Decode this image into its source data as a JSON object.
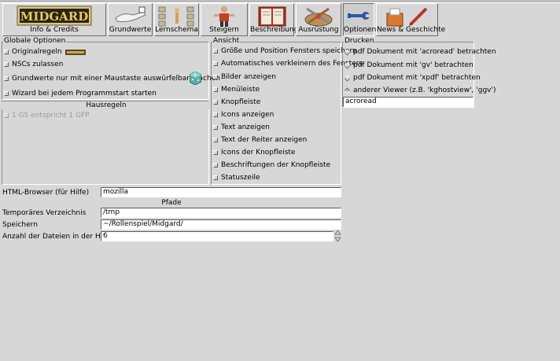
{
  "toolbar": {
    "items": [
      {
        "label": "Info & Credits",
        "logo_text": "MIDGARD"
      },
      {
        "label": "Grundwerte"
      },
      {
        "label": "Lernschema"
      },
      {
        "label": "Steigern"
      },
      {
        "label": "Beschreibung"
      },
      {
        "label": "Ausrüstung"
      },
      {
        "label": "Optionen",
        "active": true
      },
      {
        "label": "News & Geschichte"
      }
    ]
  },
  "global_options": {
    "title": "Globale Optionen",
    "items": [
      {
        "label": "Originalregeln",
        "checked": false
      },
      {
        "label": "NSCs zulassen",
        "checked": false
      },
      {
        "label": "Grundwerte nur mit einer Maustaste auswürfelbar machen",
        "checked": false
      },
      {
        "label": "Wizard bei jedem Programmstart starten",
        "checked": false
      }
    ]
  },
  "house_rules": {
    "title": "Hausregeln",
    "items": [
      {
        "label": "1 GS entspricht 1 GFP",
        "checked": false,
        "disabled": true
      }
    ]
  },
  "view": {
    "title": "Ansicht",
    "items": [
      {
        "label": "Größe und Position Fensters speichern"
      },
      {
        "label": "Automatisches verkleinern des Fensters"
      },
      {
        "label": "Bilder anzeigen"
      },
      {
        "label": "Menüleiste"
      },
      {
        "label": "Knopfleiste"
      },
      {
        "label": "Icons anzeigen"
      },
      {
        "label": "Text anzeigen"
      },
      {
        "label": "Text der Reiter anzeigen"
      },
      {
        "label": "Icons der Knopfleiste"
      },
      {
        "label": "Beschriftungen der Knopfleiste"
      },
      {
        "label": "Statuszeile"
      }
    ]
  },
  "print": {
    "title": "Drucken",
    "options": [
      {
        "label": "pdf Dokument mit 'acroread' betrachten",
        "selected": false
      },
      {
        "label": "pdf Dokument mit 'gv' betrachten",
        "selected": false
      },
      {
        "label": "pdf Dokument mit 'xpdf' betrachten",
        "selected": false
      },
      {
        "label": "anderer Viewer (z.B. 'kghostview', 'ggv')",
        "selected": true
      }
    ],
    "viewer_value": "acroread"
  },
  "browser": {
    "label": "HTML-Browser (für Hilfe)",
    "value": "mozilla"
  },
  "paths": {
    "title": "Pfade",
    "temp_label": "Temporäres Verzeichnis",
    "temp_value": "/tmp",
    "save_label": "Speichern",
    "save_value": "~/Rollenspiel/Midgard/",
    "history_label": "Anzahl der Dateien in der History",
    "history_value": "6"
  }
}
